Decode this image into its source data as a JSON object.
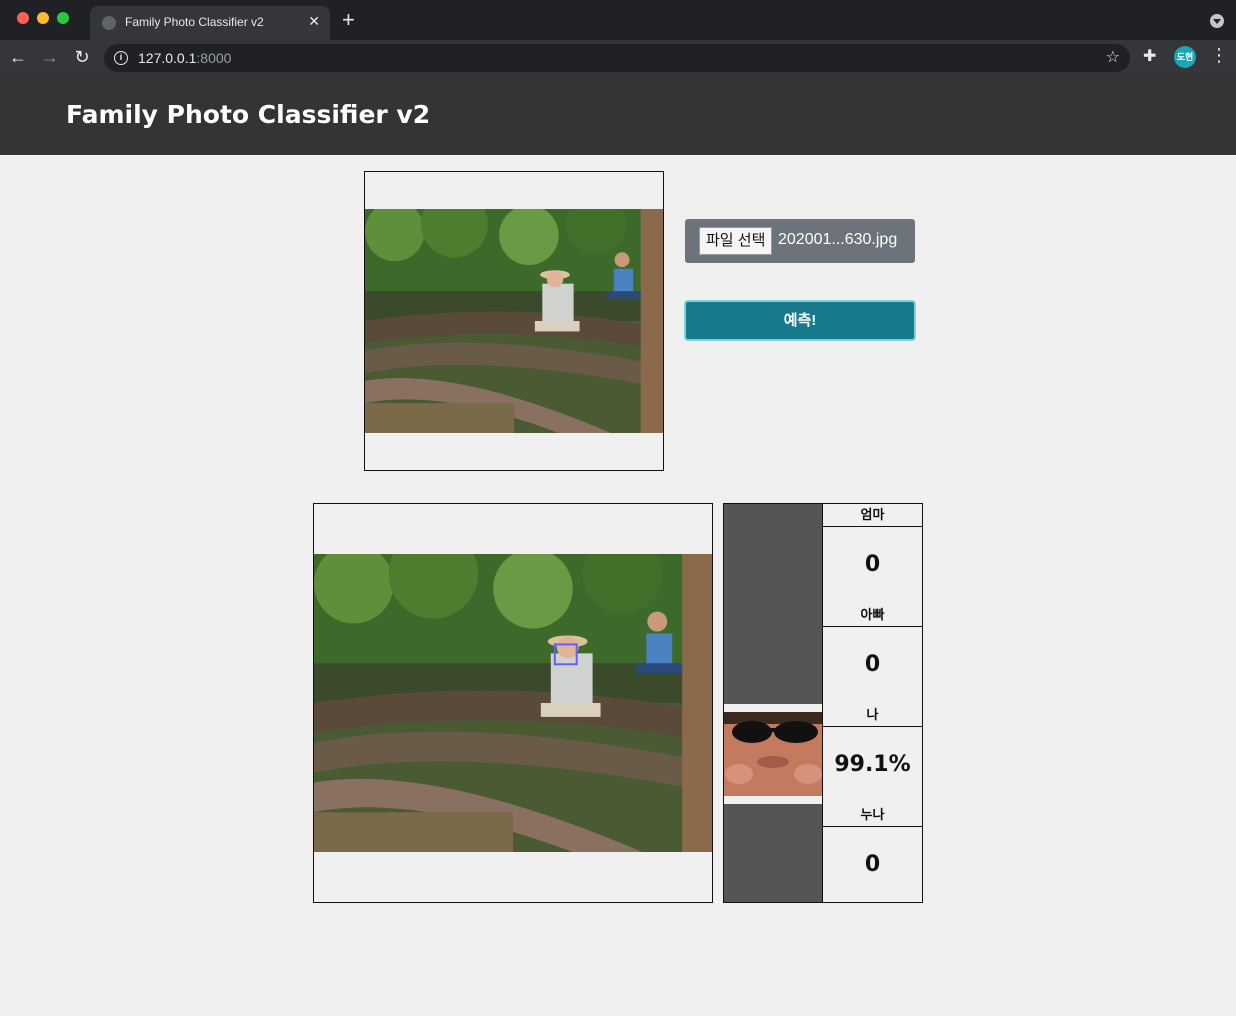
{
  "browser": {
    "tab_title": "Family Photo Classifier v2",
    "url_host": "127.0.0.1",
    "url_port": ":8000",
    "profile_initials": "도현"
  },
  "header": {
    "title": "Family Photo Classifier v2"
  },
  "upload": {
    "choose_file_label": "파일 선택",
    "file_name": "202001...630.jpg",
    "predict_label": "예측!"
  },
  "results": [
    {
      "name": "엄마",
      "score": "0"
    },
    {
      "name": "아빠",
      "score": "0"
    },
    {
      "name": "나",
      "score": "99.1%"
    },
    {
      "name": "누나",
      "score": "0"
    }
  ],
  "colors": {
    "header_bg": "#343434",
    "predict_button": "#17798c",
    "file_picker": "#6c737b",
    "detection_box": "#6060ff"
  }
}
